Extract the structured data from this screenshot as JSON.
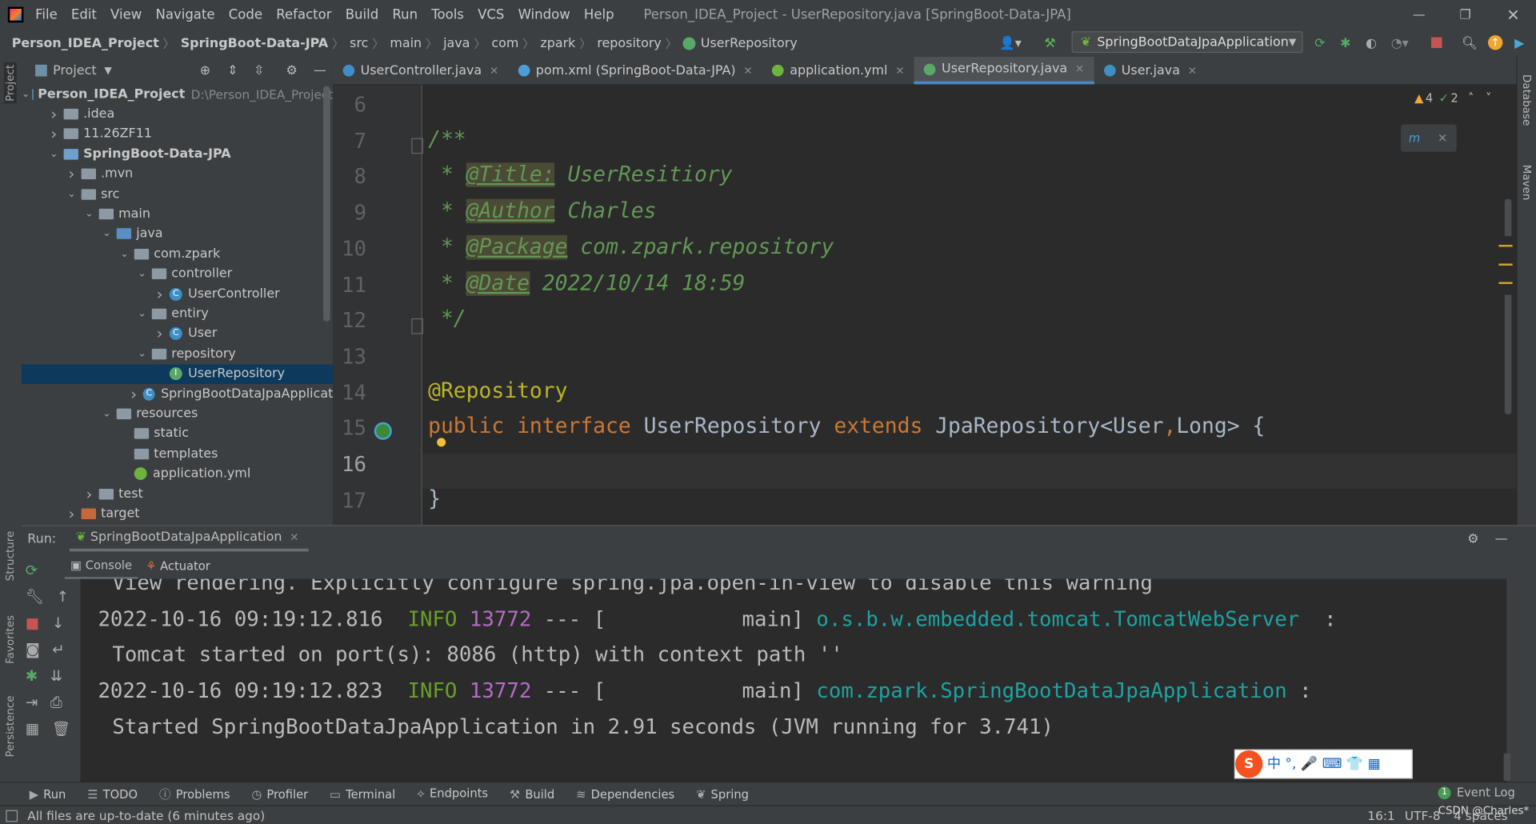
{
  "menu": [
    "File",
    "Edit",
    "View",
    "Navigate",
    "Code",
    "Refactor",
    "Build",
    "Run",
    "Tools",
    "VCS",
    "Window",
    "Help"
  ],
  "window_title": "Person_IDEA_Project - UserRepository.java [SpringBoot-Data-JPA]",
  "breadcrumb": [
    "Person_IDEA_Project",
    "SpringBoot-Data-JPA",
    "src",
    "main",
    "java",
    "com",
    "zpark",
    "repository",
    "UserRepository"
  ],
  "run_config": "SpringBootDataJpaApplication",
  "project": {
    "title": "Project",
    "tree": [
      {
        "label": "Person_IDEA_Project",
        "hint": "D:\\Person_IDEA_Project",
        "depth": 0,
        "chev": "v",
        "type": "module",
        "bold": true
      },
      {
        "label": ".idea",
        "depth": 1,
        "chev": ">",
        "type": "folder"
      },
      {
        "label": "11.26ZF11",
        "depth": 1,
        "chev": ">",
        "type": "folder"
      },
      {
        "label": "SpringBoot-Data-JPA",
        "depth": 1,
        "chev": "v",
        "type": "module",
        "bold": true
      },
      {
        "label": ".mvn",
        "depth": 2,
        "chev": ">",
        "type": "folder"
      },
      {
        "label": "src",
        "depth": 2,
        "chev": "v",
        "type": "folder"
      },
      {
        "label": "main",
        "depth": 3,
        "chev": "v",
        "type": "folder"
      },
      {
        "label": "java",
        "depth": 4,
        "chev": "v",
        "type": "srcfolder"
      },
      {
        "label": "com.zpark",
        "depth": 5,
        "chev": "v",
        "type": "package"
      },
      {
        "label": "controller",
        "depth": 6,
        "chev": "v",
        "type": "package"
      },
      {
        "label": "UserController",
        "depth": 7,
        "chev": ">",
        "type": "class"
      },
      {
        "label": "entiry",
        "depth": 6,
        "chev": "v",
        "type": "package"
      },
      {
        "label": "User",
        "depth": 7,
        "chev": ">",
        "type": "class"
      },
      {
        "label": "repository",
        "depth": 6,
        "chev": "v",
        "type": "package"
      },
      {
        "label": "UserRepository",
        "depth": 7,
        "chev": "",
        "type": "interface",
        "selected": true
      },
      {
        "label": "SpringBootDataJpaApplicat",
        "depth": 6,
        "chev": ">",
        "type": "springclass"
      },
      {
        "label": "resources",
        "depth": 4,
        "chev": "v",
        "type": "folder"
      },
      {
        "label": "static",
        "depth": 5,
        "chev": "",
        "type": "folder"
      },
      {
        "label": "templates",
        "depth": 5,
        "chev": "",
        "type": "folder"
      },
      {
        "label": "application.yml",
        "depth": 5,
        "chev": "",
        "type": "yml"
      },
      {
        "label": "test",
        "depth": 3,
        "chev": ">",
        "type": "folder"
      },
      {
        "label": "target",
        "depth": 2,
        "chev": ">",
        "type": "excluded"
      }
    ]
  },
  "tabs": [
    {
      "label": "UserController.java",
      "icon": "class-icon"
    },
    {
      "label": "pom.xml (SpringBoot-Data-JPA)",
      "icon": "maven-icon"
    },
    {
      "label": "application.yml",
      "icon": "spring-icon"
    },
    {
      "label": "UserRepository.java",
      "icon": "interface-icon",
      "active": true
    },
    {
      "label": "User.java",
      "icon": "class-icon"
    }
  ],
  "editor": {
    "inspections": {
      "warnings": "4",
      "weak_warnings": "2"
    },
    "line_numbers": [
      "6",
      "7",
      "8",
      "9",
      "10",
      "11",
      "12",
      "13",
      "14",
      "15",
      "16",
      "17"
    ],
    "current_line": "16",
    "lines": {
      "l7": "/**",
      "l8": {
        "star": " * ",
        "tag": "@Title:",
        "text": " UserResitiory"
      },
      "l9": {
        "star": " * ",
        "tag": "@Author",
        "text": " Charles"
      },
      "l10": {
        "star": " * ",
        "tag": "@Package",
        "text": " com.zpark.repository"
      },
      "l11": {
        "star": " * ",
        "tag": "@Date",
        "text": " 2022/10/14 18:59"
      },
      "l12": " */",
      "l14": "@Repository",
      "l15": {
        "k1": "public",
        "k2": " interface",
        "name": " UserRepository",
        "k3": " extends",
        "rest": " JpaRepository<User",
        "comma": ",",
        "rest2": "Long> {"
      },
      "l17": "}"
    }
  },
  "right_strip": [
    "Database",
    "Maven"
  ],
  "left_strip": [
    "Project",
    "Structure",
    "Favorites",
    "Persistence"
  ],
  "run": {
    "label": "Run:",
    "tab": "SpringBootDataJpaApplication",
    "subtabs": [
      "Console",
      "Actuator"
    ],
    "console": [
      {
        "text": " View rendering. Explicitly configure spring.jpa.open-in-view to disable this warning"
      },
      {
        "time": "2022-10-16 09:19:12.816  ",
        "level": "INFO",
        "pid": " 13772",
        "mid": " --- [           main] ",
        "logger": "o.s.b.w.embedded.tomcat.TomcatWebServer",
        "end": "  :"
      },
      {
        "text": " Tomcat started on port(s): 8086 (http) with context path ''"
      },
      {
        "time": "2022-10-16 09:19:12.823  ",
        "level": "INFO",
        "pid": " 13772",
        "mid": " --- [           main] ",
        "logger": "com.zpark.SpringBootDataJpaApplication",
        "end": " :"
      },
      {
        "text": " Started SpringBootDataJpaApplication in 2.91 seconds (JVM running for 3.741)"
      }
    ]
  },
  "ime": {
    "text": "中 °, 🎤 ⌨ 👕 ▦"
  },
  "bottom_tools": [
    "Run",
    "TODO",
    "Problems",
    "Profiler",
    "Terminal",
    "Endpoints",
    "Build",
    "Dependencies",
    "Spring"
  ],
  "event_log": {
    "count": "1",
    "label": "Event Log"
  },
  "status": {
    "message": "All files are up-to-date (6 minutes ago)",
    "position": "16:1",
    "encoding": "UTF-8",
    "indent": "4 spaces",
    "watermark": "CSDN @Charles*"
  },
  "colors": {
    "accent": "#4a88c7",
    "comment": "#629755",
    "keyword": "#cc7832",
    "annotation": "#bbb529",
    "info": "#6a9e2b",
    "pid": "#b56cc4",
    "logger": "#1fa2a2"
  }
}
